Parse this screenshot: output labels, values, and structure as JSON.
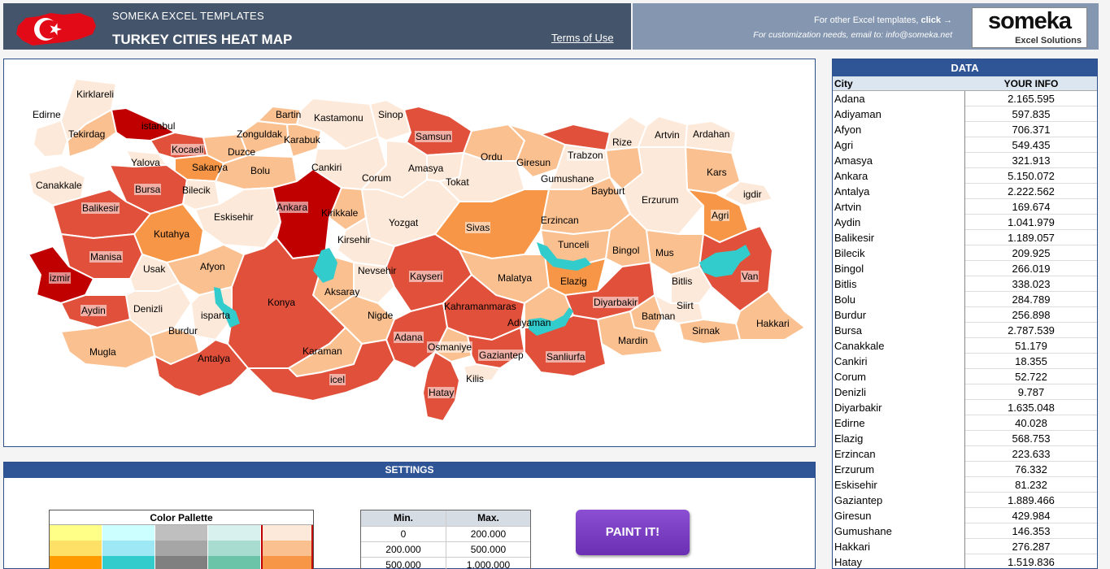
{
  "header": {
    "subtitle": "SOMEKA EXCEL TEMPLATES",
    "title": "TURKEY CITIES HEAT MAP",
    "terms_link": "Terms of Use",
    "other_templates": "For other Excel templates,",
    "click_label": "click →",
    "customization": "For customization needs, email to: info@someka.net",
    "logo_main": "someka",
    "logo_sub": "Excel Solutions"
  },
  "map": {
    "cities": [
      {
        "name": "Kirklareli"
      },
      {
        "name": "Edirne"
      },
      {
        "name": "istanbul"
      },
      {
        "name": "Tekirdag"
      },
      {
        "name": "Kocaeli"
      },
      {
        "name": "Yalova"
      },
      {
        "name": "Sakarya"
      },
      {
        "name": "Duzce"
      },
      {
        "name": "Bartin"
      },
      {
        "name": "Kastamonu"
      },
      {
        "name": "Sinop"
      },
      {
        "name": "Zonguldak"
      },
      {
        "name": "Karabuk"
      },
      {
        "name": "Bolu"
      },
      {
        "name": "Samsun"
      },
      {
        "name": "Canakkale"
      },
      {
        "name": "Bursa"
      },
      {
        "name": "Bilecik"
      },
      {
        "name": "Cankiri"
      },
      {
        "name": "Corum"
      },
      {
        "name": "Amasya"
      },
      {
        "name": "Tokat"
      },
      {
        "name": "Ordu"
      },
      {
        "name": "Giresun"
      },
      {
        "name": "Trabzon"
      },
      {
        "name": "Rize"
      },
      {
        "name": "Artvin"
      },
      {
        "name": "Ardahan"
      },
      {
        "name": "Gumushane"
      },
      {
        "name": "Bayburt"
      },
      {
        "name": "Kars"
      },
      {
        "name": "igdir"
      },
      {
        "name": "Erzurum"
      },
      {
        "name": "Balikesir"
      },
      {
        "name": "Eskisehir"
      },
      {
        "name": "Ankara"
      },
      {
        "name": "Kirikkale"
      },
      {
        "name": "Yozgat"
      },
      {
        "name": "Sivas"
      },
      {
        "name": "Erzincan"
      },
      {
        "name": "Agri"
      },
      {
        "name": "Kutahya"
      },
      {
        "name": "Kirsehir"
      },
      {
        "name": "Tunceli"
      },
      {
        "name": "Bingol"
      },
      {
        "name": "Mus"
      },
      {
        "name": "Manisa"
      },
      {
        "name": "Afyon"
      },
      {
        "name": "Usak"
      },
      {
        "name": "Nevsehir"
      },
      {
        "name": "Kayseri"
      },
      {
        "name": "Malatya"
      },
      {
        "name": "Elazig"
      },
      {
        "name": "Bitlis"
      },
      {
        "name": "Van"
      },
      {
        "name": "izmir"
      },
      {
        "name": "Aksaray"
      },
      {
        "name": "Konya"
      },
      {
        "name": "Kahramanmaras"
      },
      {
        "name": "Diyarbakir"
      },
      {
        "name": "Siirt"
      },
      {
        "name": "Aydin"
      },
      {
        "name": "Denizli"
      },
      {
        "name": "isparta"
      },
      {
        "name": "Nigde"
      },
      {
        "name": "Adiyaman"
      },
      {
        "name": "Batman"
      },
      {
        "name": "Sirnak"
      },
      {
        "name": "Hakkari"
      },
      {
        "name": "Burdur"
      },
      {
        "name": "Adana"
      },
      {
        "name": "Mardin"
      },
      {
        "name": "Osmaniye"
      },
      {
        "name": "Mugla"
      },
      {
        "name": "Karaman"
      },
      {
        "name": "Gaziantep"
      },
      {
        "name": "Sanliurfa"
      },
      {
        "name": "Antalya"
      },
      {
        "name": "icel"
      },
      {
        "name": "Kilis"
      },
      {
        "name": "Hatay"
      }
    ]
  },
  "settings": {
    "title": "SETTINGS",
    "palette_title": "Color Pallette",
    "palette_colors": [
      [
        "#ffff88",
        "#ccffff",
        "#bfbfbf",
        "#d8f0ee",
        "#fde9d9"
      ],
      [
        "#ffe066",
        "#9ee7f5",
        "#a6a6a6",
        "#a8dcd0",
        "#fac090"
      ],
      [
        "#ff9900",
        "#33cccc",
        "#808080",
        "#6cc4a8",
        "#f79646"
      ]
    ],
    "minmax_headers": [
      "Min.",
      "Max."
    ],
    "minmax_rows": [
      [
        "0",
        "200.000"
      ],
      [
        "200.000",
        "500.000"
      ],
      [
        "500.000",
        "1.000.000"
      ]
    ],
    "paint_button": "PAINT IT!"
  },
  "data_table": {
    "title": "DATA",
    "col_city": "City",
    "col_info": "YOUR INFO",
    "rows": [
      [
        "Adana",
        "2.165.595"
      ],
      [
        "Adiyaman",
        "597.835"
      ],
      [
        "Afyon",
        "706.371"
      ],
      [
        "Agri",
        "549.435"
      ],
      [
        "Amasya",
        "321.913"
      ],
      [
        "Ankara",
        "5.150.072"
      ],
      [
        "Antalya",
        "2.222.562"
      ],
      [
        "Artvin",
        "169.674"
      ],
      [
        "Aydin",
        "1.041.979"
      ],
      [
        "Balikesir",
        "1.189.057"
      ],
      [
        "Bilecik",
        "209.925"
      ],
      [
        "Bingol",
        "266.019"
      ],
      [
        "Bitlis",
        "338.023"
      ],
      [
        "Bolu",
        "284.789"
      ],
      [
        "Burdur",
        "256.898"
      ],
      [
        "Bursa",
        "2.787.539"
      ],
      [
        "Canakkale",
        "51.179"
      ],
      [
        "Cankiri",
        "18.355"
      ],
      [
        "Corum",
        "52.722"
      ],
      [
        "Denizli",
        "9.787"
      ],
      [
        "Diyarbakir",
        "1.635.048"
      ],
      [
        "Edirne",
        "40.028"
      ],
      [
        "Elazig",
        "568.753"
      ],
      [
        "Erzincan",
        "223.633"
      ],
      [
        "Erzurum",
        "76.332"
      ],
      [
        "Eskisehir",
        "81.232"
      ],
      [
        "Gaziantep",
        "1.889.466"
      ],
      [
        "Giresun",
        "429.984"
      ],
      [
        "Gumushane",
        "146.353"
      ],
      [
        "Hakkari",
        "276.287"
      ],
      [
        "Hatay",
        "1.519.836"
      ]
    ]
  },
  "colors": {
    "header_dark": "#44546a",
    "header_light": "#8496b0",
    "panel_blue": "#2f5597",
    "heat_1": "#fde9d9",
    "heat_2": "#fac090",
    "heat_3": "#f79646",
    "heat_4": "#e0503a",
    "heat_5": "#c00000",
    "lake": "#33cccc"
  }
}
